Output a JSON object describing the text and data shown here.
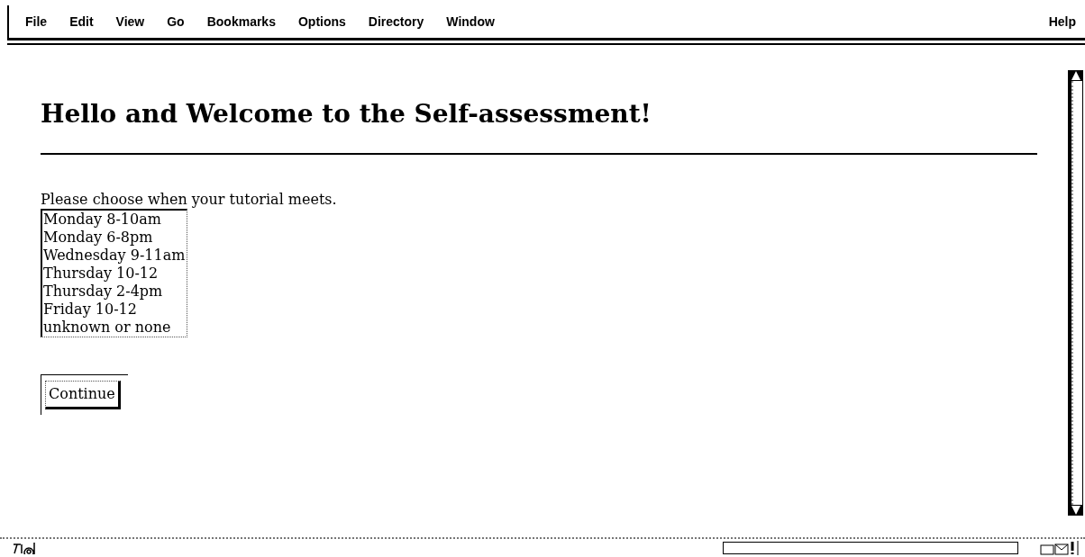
{
  "menu": [
    "File",
    "Edit",
    "View",
    "Go",
    "Bookmarks",
    "Options",
    "Directory",
    "Window"
  ],
  "help_menu": "Help",
  "heading": "Hello and Welcome to the Self-assessment!",
  "prompt": "Please choose when your tutorial meets.",
  "options": [
    {
      "label": "Monday 8-10am",
      "selected": false
    },
    {
      "label": "Monday 6-8pm",
      "selected": false
    },
    {
      "label": "Wednesday 9-11am",
      "selected": false
    },
    {
      "label": "Thursday 10-12",
      "selected": false
    },
    {
      "label": "Thursday 2-4pm",
      "selected": false
    },
    {
      "label": "Friday 10-12",
      "selected": false
    },
    {
      "label": "unknown or none",
      "selected": false
    }
  ],
  "button": "Continue"
}
